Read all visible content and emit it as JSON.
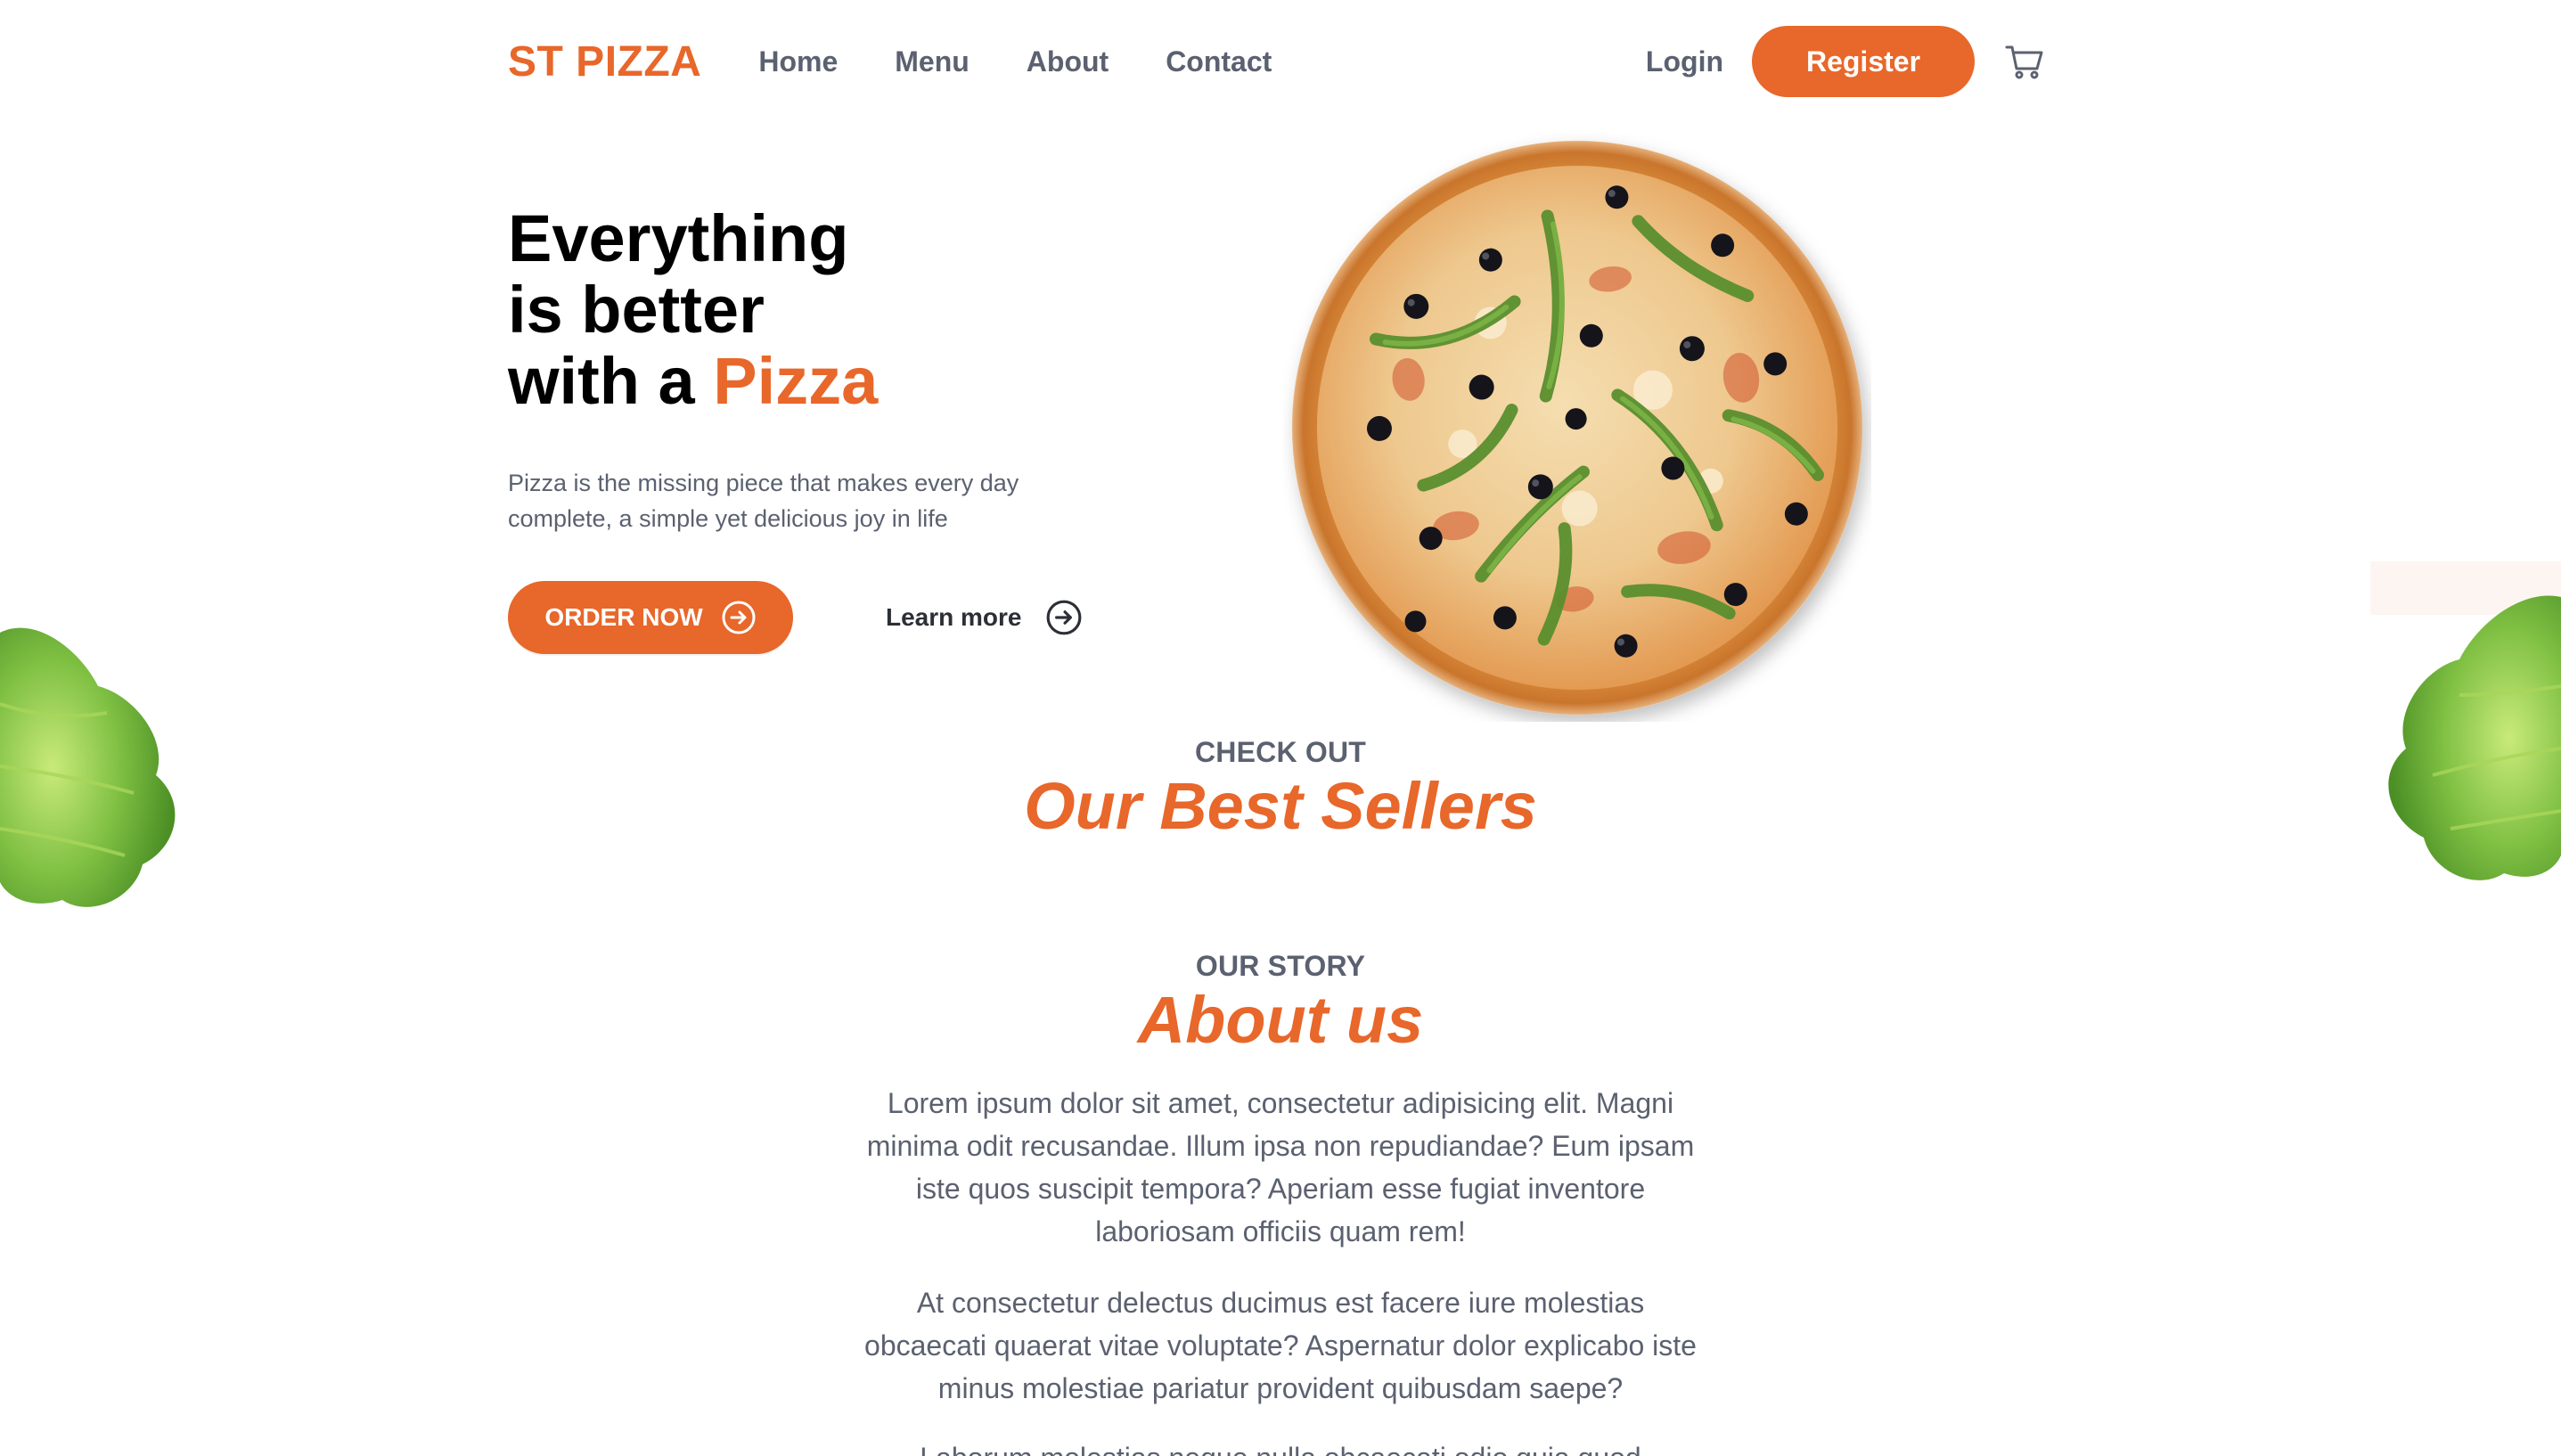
{
  "header": {
    "logo": "ST PIZZA",
    "nav": [
      "Home",
      "Menu",
      "About",
      "Contact"
    ],
    "login": "Login",
    "register": "Register",
    "cart_icon": "cart-icon"
  },
  "hero": {
    "title_line1": "Everything",
    "title_line2": "is better",
    "title_line3_prefix": "with a ",
    "title_line3_accent": "Pizza",
    "description": "Pizza is the missing piece that makes every day complete, a simple yet delicious joy in life",
    "order_button": "ORDER NOW",
    "learn_button": "Learn more"
  },
  "best_sellers": {
    "eyebrow": "CHECK OUT",
    "title": "Our Best Sellers"
  },
  "about": {
    "eyebrow": "OUR STORY",
    "title": "About us",
    "paragraphs": [
      "Lorem ipsum dolor sit amet, consectetur adipisicing elit. Magni minima odit recusandae. Illum ipsa non repudiandae? Eum ipsam iste quos suscipit tempora? Aperiam esse fugiat inventore laboriosam officiis quam rem!",
      "At consectetur delectus ducimus est facere iure molestias obcaecati quaerat vitae voluptate? Aspernatur dolor explicabo iste minus molestiae pariatur provident quibusdam saepe?",
      "Laborum molestias neque nulla obcaecati odio quia quod"
    ]
  },
  "colors": {
    "accent": "#e8672a",
    "text_muted": "#5b6170",
    "heading": "#000000"
  }
}
